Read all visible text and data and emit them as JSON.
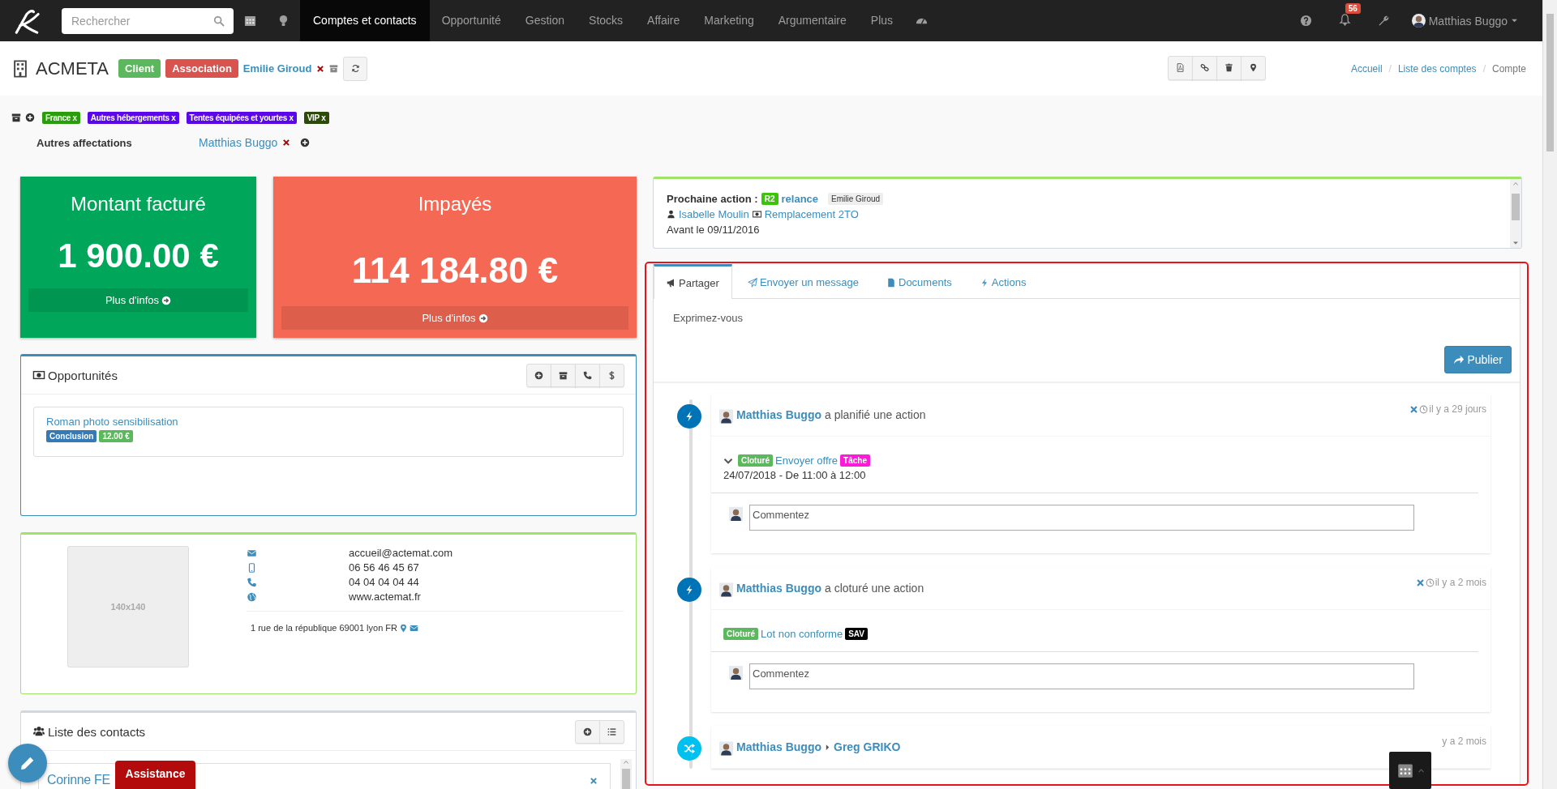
{
  "navbar": {
    "search_placeholder": "Rechercher",
    "menu": [
      {
        "label": "Comptes et contacts",
        "selected": true
      },
      {
        "label": "Opportunité",
        "selected": false
      },
      {
        "label": "Gestion",
        "selected": false
      },
      {
        "label": "Stocks",
        "selected": false
      },
      {
        "label": "Affaire",
        "selected": false
      },
      {
        "label": "Marketing",
        "selected": false
      },
      {
        "label": "Argumentaire",
        "selected": false
      },
      {
        "label": "Plus",
        "selected": false
      }
    ],
    "notifications": "56",
    "user": "Matthias Buggo"
  },
  "header": {
    "title": "ACMETA",
    "badges": [
      {
        "label": "Client",
        "color": "#5cb85c"
      },
      {
        "label": "Association",
        "color": "#d9534f"
      }
    ],
    "owner": "Emilie Giroud",
    "breadcrumb_separator": "/",
    "breadcrumb": [
      "Accueil",
      "Liste des comptes",
      "Compte"
    ]
  },
  "tags": [
    {
      "label": "France x",
      "color": "#2a9d0c"
    },
    {
      "label": "Autres hébergements x",
      "color": "#5a08e8"
    },
    {
      "label": "Tentes équipées et yourtes x",
      "color": "#5a08e8"
    },
    {
      "label": "VIP x",
      "color": "#2e4a0a"
    }
  ],
  "affectations": {
    "label": "Autres affectations",
    "user": "Matthias Buggo"
  },
  "stats": [
    {
      "title": "Montant facturé",
      "value": "1 900.00 €",
      "link": "Plus d'infos",
      "color": "#00a65a"
    },
    {
      "title": "Impayés",
      "value": "114 184.80 €",
      "link": "Plus d'infos",
      "color": "#f56954"
    }
  ],
  "opportunities": {
    "title": "Opportunités",
    "items": [
      {
        "name": "Roman photo sensibilisation",
        "stage": "Conclusion",
        "amount": "12.00 €"
      }
    ]
  },
  "contact_card": {
    "photo": "140x140",
    "email": "accueil@actemat.com",
    "mobile": "06 56 46 45 67",
    "phone": "04 04 04 04 44",
    "website": "www.actemat.fr",
    "address": "1 rue de la république 69001 lyon FR"
  },
  "contacts": {
    "title": "Liste des contacts",
    "items": [
      {
        "name": "Corinne FE"
      }
    ]
  },
  "next_action": {
    "label": "Prochaine action :",
    "code": "R2",
    "name": "relance",
    "assignee": "Emilie Giroud",
    "contact": "Isabelle Moulin",
    "opportunity": "Remplacement 2TO",
    "due": "Avant le 09/11/2016"
  },
  "activity": {
    "tabs": [
      {
        "label": "Partager",
        "selected": true
      },
      {
        "label": "Envoyer un message",
        "selected": false
      },
      {
        "label": "Documents",
        "selected": false
      },
      {
        "label": "Actions",
        "selected": false
      }
    ],
    "placeholder": "Exprimez-vous",
    "publish": "Publier",
    "timeline": [
      {
        "kind": "action",
        "user": "Matthias Buggo",
        "verb": "a planifié une action",
        "time": "il y a 29 jours",
        "collapsible": true,
        "status": "Cloturé",
        "title": "Envoyer offre",
        "tag": {
          "label": "Tâche",
          "color": "#ff1ad9"
        },
        "date": "24/07/2018 - De 11:00 à 12:00",
        "comment_placeholder": "Commentez"
      },
      {
        "kind": "action",
        "user": "Matthias Buggo",
        "verb": "a cloturé une action",
        "time": "il y a 2 mois",
        "collapsible": false,
        "status": "Cloturé",
        "title": "Lot non conforme",
        "tag": {
          "label": "SAV",
          "color": "#000000"
        },
        "comment_placeholder": "Commentez"
      },
      {
        "kind": "transfer",
        "user": "Matthias Buggo",
        "target": "Greg GRIKO",
        "time": "y a 2 mois"
      }
    ]
  },
  "assistance": "Assistance"
}
